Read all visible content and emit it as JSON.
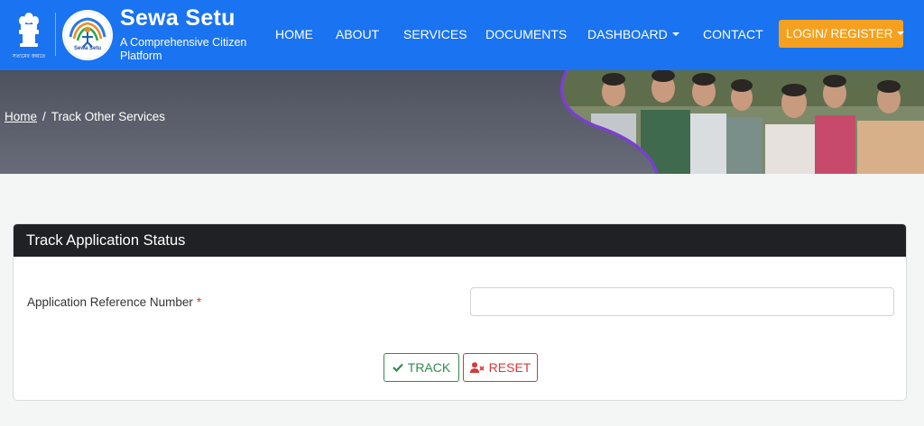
{
  "header": {
    "emblem_caption": "সত্যমেব জয়তে",
    "logo_text": "Sewa Setu",
    "brand_title": "Sewa Setu",
    "brand_subtitle": "A Comprehensive Citizen Platform",
    "nav": {
      "home": "HOME",
      "about": "ABOUT",
      "services": "SERVICES",
      "documents": "DOCUMENTS",
      "dashboard": "DASHBOARD",
      "contact": "CONTACT"
    },
    "login_label": "LOGIN/ REGISTER",
    "colors": {
      "bar": "#1a73f0",
      "login": "#f5a11f"
    }
  },
  "breadcrumb": {
    "home": "Home",
    "separator": "/",
    "current": "Track Other Services"
  },
  "card": {
    "title": "Track Application Status",
    "field_label": "Application Reference Number",
    "required_mark": "*",
    "input_value": "",
    "input_placeholder": "",
    "track_label": "TRACK",
    "reset_label": "RESET",
    "colors": {
      "track": "#2e8b4a",
      "reset": "#d33a3a",
      "header": "#202124"
    }
  },
  "icons": {
    "emblem": "state-emblem-icon",
    "logo": "sewa-setu-logo-icon",
    "track": "check-icon",
    "reset": "user-times-icon",
    "dropdown": "caret-down-icon"
  }
}
